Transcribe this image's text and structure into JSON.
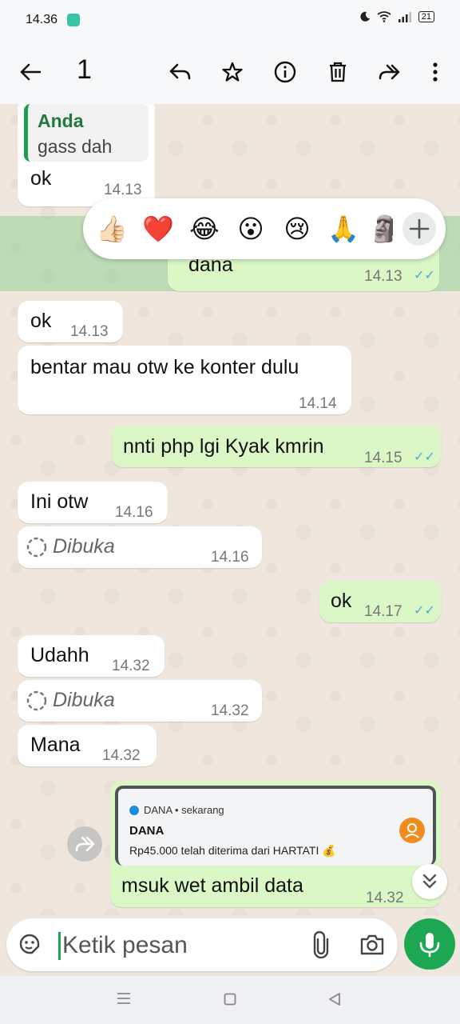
{
  "status": {
    "time": "14.36",
    "battery": "21"
  },
  "toolbar": {
    "selected_count": "1"
  },
  "messages": [
    {
      "quote_author": "Anda",
      "quote_text": "gass dah",
      "text": "ok",
      "time": "14.13"
    },
    {
      "text": "dana",
      "time": "14.13"
    },
    {
      "text": "ok",
      "time": "14.13"
    },
    {
      "text": "bentar mau otw ke konter dulu",
      "time": "14.14"
    },
    {
      "text": "nnti php lgi Kyak kmrin",
      "time": "14.15"
    },
    {
      "text": "Ini otw",
      "time": "14.16"
    },
    {
      "text": "Dibuka",
      "time": "14.16"
    },
    {
      "text": "ok",
      "time": "14.17"
    },
    {
      "text": "Udahh",
      "time": "14.32"
    },
    {
      "text": "Dibuka",
      "time": "14.32"
    },
    {
      "text": "Mana",
      "time": "14.32"
    },
    {
      "notif_app": "DANA • sekarang",
      "notif_title": "DANA",
      "notif_body": "Rp45.000 telah diterima dari HARTATI 💰",
      "text": "msuk wet ambil data",
      "time": "14.32"
    }
  ],
  "reactions": [
    "👍🏻",
    "❤️",
    "😂",
    "😮",
    "😢",
    "🙏",
    "🗿"
  ],
  "input": {
    "placeholder": "Ketik pesan"
  },
  "icons": {
    "back": "arrow-left-icon",
    "reply": "reply-icon",
    "star": "star-icon",
    "info": "info-icon",
    "delete": "trash-icon",
    "forward": "forward-icon",
    "more": "more-vertical-icon",
    "emoji_sticker": "sticker-icon",
    "attach": "paperclip-icon",
    "camera": "camera-icon",
    "mic": "mic-icon"
  },
  "colors": {
    "outgoing": "#dbf7c6",
    "incoming": "#ffffff",
    "accent": "#1ea753",
    "ticks": "#4aa7e6",
    "selection": "#a8d9a0"
  }
}
